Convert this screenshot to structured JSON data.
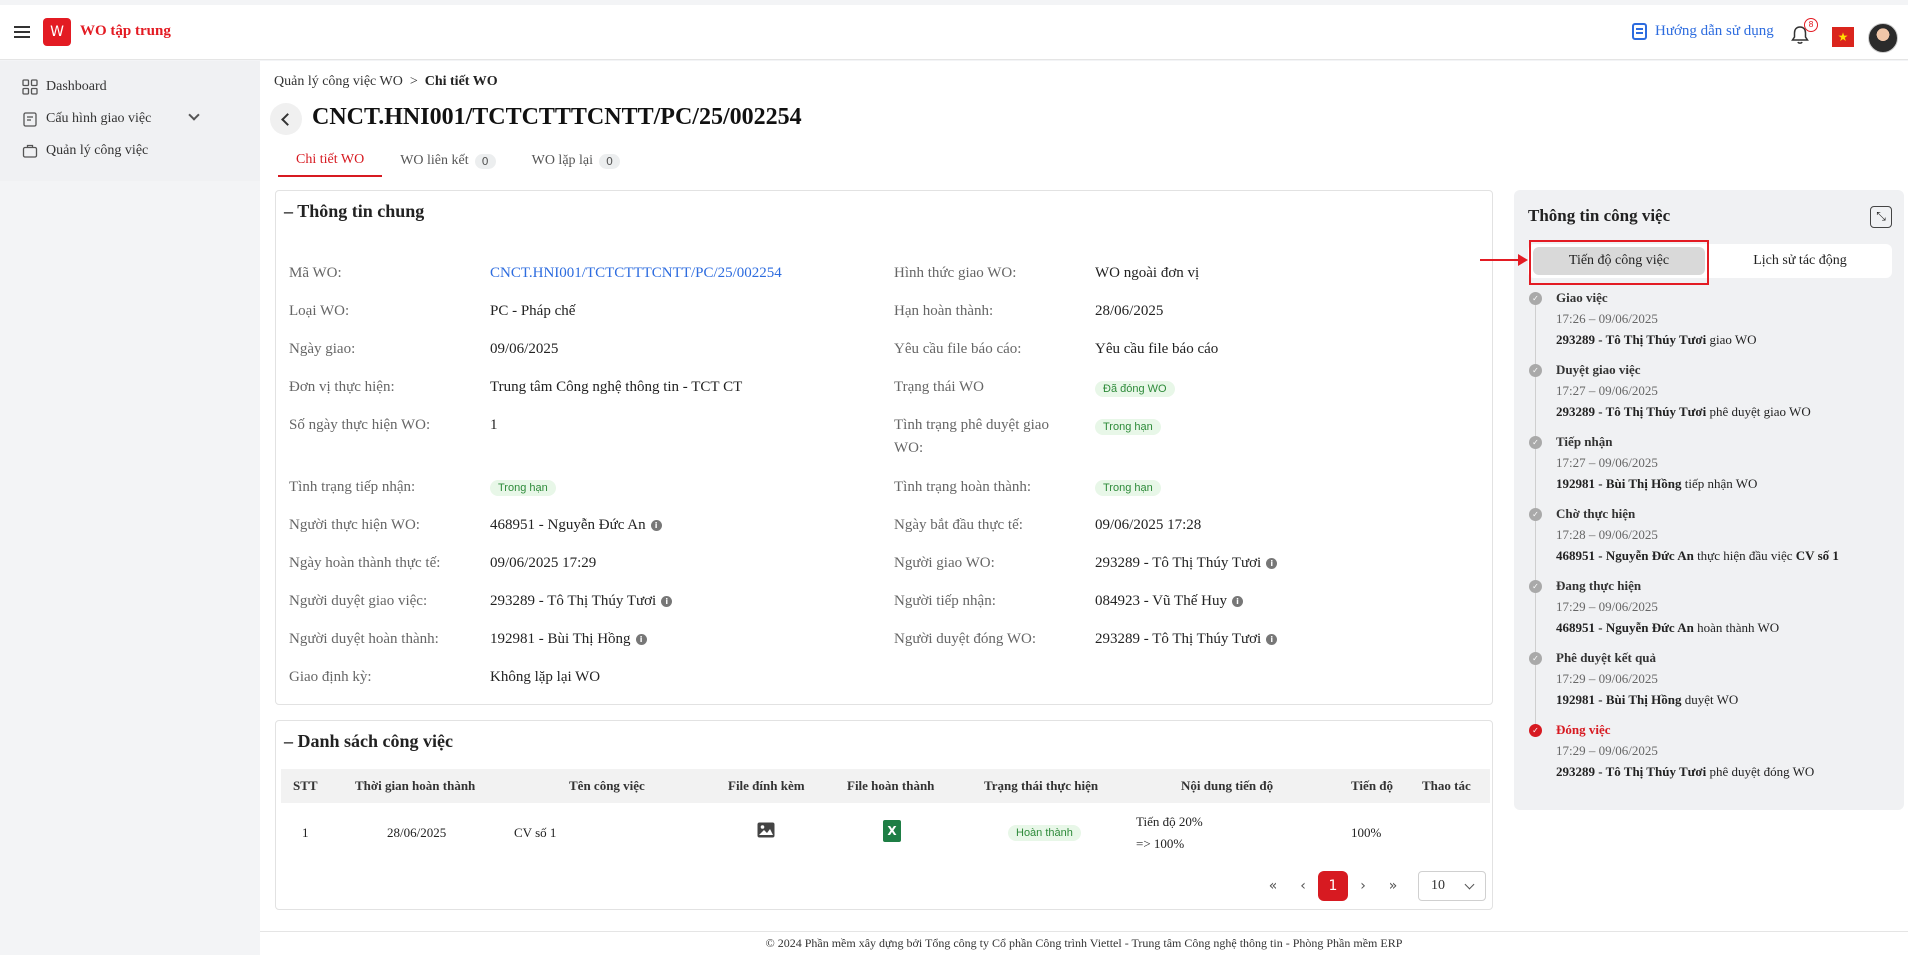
{
  "header": {
    "app_title": "WO tập trung",
    "logo_text": "W",
    "help_label": "Hướng dẫn sử dụng",
    "notification_count": "8",
    "flag_star": "★"
  },
  "sidebar": {
    "items": [
      {
        "label": "Dashboard"
      },
      {
        "label": "Cấu hình giao việc"
      },
      {
        "label": "Quản lý công việc"
      }
    ]
  },
  "breadcrumb": {
    "parent": "Quản lý công việc WO",
    "separator": ">",
    "current": "Chi tiết WO"
  },
  "page_title": "CNCT.HNI001/TCTCTTTCNTT/PC/25/002254",
  "tabs": [
    {
      "label": "Chi tiết WO",
      "count": ""
    },
    {
      "label": "WO liên kết",
      "count": "0"
    },
    {
      "label": "WO lặp lại",
      "count": "0"
    }
  ],
  "general": {
    "title": "Thông tin chung",
    "collapse": "–",
    "left": [
      {
        "label": "Mã WO:",
        "value": "CNCT.HNI001/TCTCTTTCNTT/PC/25/002254"
      },
      {
        "label": "Loại WO:",
        "value": "PC - Pháp chế"
      },
      {
        "label": "Ngày giao:",
        "value": "09/06/2025"
      },
      {
        "label": "Đơn vị thực hiện:",
        "value": "Trung tâm Công nghệ thông tin - TCT CT"
      },
      {
        "label": "Số ngày thực hiện WO:",
        "value": "1"
      },
      {
        "label": "Tình trạng tiếp nhận:",
        "value": "Trong hạn"
      },
      {
        "label": "Người thực hiện WO:",
        "value": "468951 - Nguyễn Đức An"
      },
      {
        "label": "Ngày hoàn thành thực tế:",
        "value": "09/06/2025 17:29"
      },
      {
        "label": "Người duyệt giao việc:",
        "value": "293289 - Tô Thị Thúy Tươi"
      },
      {
        "label": "Người duyệt hoàn thành:",
        "value": "192981 - Bùi Thị Hồng"
      },
      {
        "label": "Giao định kỳ:",
        "value": "Không lặp lại WO"
      }
    ],
    "right": [
      {
        "label": "Hình thức giao WO:",
        "value": "WO ngoài đơn vị"
      },
      {
        "label": "Hạn hoàn thành:",
        "value": "28/06/2025"
      },
      {
        "label": "Yêu cầu file báo cáo:",
        "value": "Yêu cầu file báo cáo"
      },
      {
        "label": "Trạng thái WO",
        "value": "Đã đóng WO"
      },
      {
        "label": "Tình trạng phê duyệt giao",
        "label2": "WO:",
        "value": "Trong hạn"
      },
      {
        "label": "Tình trạng hoàn thành:",
        "value": "Trong hạn"
      },
      {
        "label": "Ngày bắt đầu thực tế:",
        "value": "09/06/2025 17:28"
      },
      {
        "label": "Người giao WO:",
        "value": "293289 - Tô Thị Thúy Tươi"
      },
      {
        "label": "Người tiếp nhận:",
        "value": "084923 - Vũ Thế Huy"
      },
      {
        "label": "Người duyệt đóng WO:",
        "value": "293289 - Tô Thị Thúy Tươi"
      }
    ],
    "info_glyph": "i"
  },
  "tasks": {
    "title": "Danh sách công việc",
    "columns": [
      "STT",
      "Thời gian hoàn thành",
      "Tên công việc",
      "File đính kèm",
      "File hoàn thành",
      "Trạng thái thực hiện",
      "Nội dung tiến độ",
      "Tiến độ",
      "Thao tác"
    ],
    "rows": [
      {
        "stt": "1",
        "deadline": "28/06/2025",
        "name": "CV số 1",
        "status": "Hoàn thành",
        "progress_line1": "Tiến độ 20%",
        "progress_line2": "=> 100%",
        "progress": "100%"
      }
    ],
    "excel_glyph": "X"
  },
  "pagination": {
    "first": "«",
    "prev": "‹",
    "current": "1",
    "next": "›",
    "last": "»",
    "page_size": "10"
  },
  "footer": "© 2024 Phần mềm xây dựng bởi Tổng công ty Cổ phần Công trình Viettel - Trung tâm Công nghệ thông tin - Phòng Phần mềm ERP",
  "right_panel": {
    "title": "Thông tin công việc",
    "collapse_glyph": "⤡",
    "tabs": [
      "Tiến độ công việc",
      "Lịch sử tác động"
    ],
    "check_glyph": "✓",
    "timeline": [
      {
        "step": "Giao việc",
        "time": "17:26 – 09/06/2025",
        "actor": "293289 - Tô Thị Thúy Tươi",
        "action": "giao WO"
      },
      {
        "step": "Duyệt giao việc",
        "time": "17:27 – 09/06/2025",
        "actor": "293289 - Tô Thị Thúy Tươi",
        "action": "phê duyệt giao WO"
      },
      {
        "step": "Tiếp nhận",
        "time": "17:27 – 09/06/2025",
        "actor": "192981 - Bùi Thị Hồng",
        "action": "tiếp nhận WO"
      },
      {
        "step": "Chờ thực hiện",
        "time": "17:28 – 09/06/2025",
        "actor": "468951 - Nguyễn Đức An",
        "action": "thực hiện đầu việc",
        "extra": "CV số 1"
      },
      {
        "step": "Đang thực hiện",
        "time": "17:29 – 09/06/2025",
        "actor": "468951 - Nguyễn Đức An",
        "action": "hoàn thành WO"
      },
      {
        "step": "Phê duyệt kết quả",
        "time": "17:29 – 09/06/2025",
        "actor": "192981 - Bùi Thị Hồng",
        "action": "duyệt WO"
      },
      {
        "step": "Đóng việc",
        "time": "17:29 – 09/06/2025",
        "actor": "293289 - Tô Thị Thúy Tươi",
        "action": "phê duyệt đóng WO"
      }
    ]
  },
  "colors": {
    "brand": "#e31b23",
    "link": "#2d6cdf",
    "success_tag_bg": "#e8f7e8",
    "success_tag_text": "#2e8b3a"
  }
}
